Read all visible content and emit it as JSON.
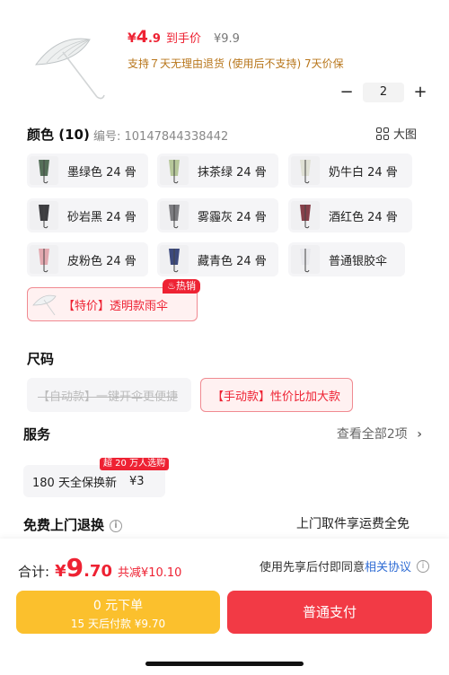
{
  "header": {
    "price_symbol": "¥",
    "price_int": "4",
    "price_dec": ".9",
    "price_label": "到手价",
    "original_price": "¥9.9",
    "policy": "支持７天无理由退货 (使用后不支持)  7天价保"
  },
  "stepper": {
    "minus": "−",
    "value": "2",
    "plus": "+"
  },
  "color": {
    "title": "颜色 (10)",
    "code": "编号: 10147844338442",
    "big_pic": "大图",
    "options": [
      {
        "label": "墨绿色 24 骨",
        "swatch": "#56705a"
      },
      {
        "label": "抹茶绿 24 骨",
        "swatch": "#b6c79a"
      },
      {
        "label": "奶牛白 24 骨",
        "swatch": "#dfe0d4"
      },
      {
        "label": "砂岩黑 24 骨",
        "swatch": "#3d3d40"
      },
      {
        "label": "雾霾灰 24 骨",
        "swatch": "#7c7c80"
      },
      {
        "label": "酒红色 24 骨",
        "swatch": "#86404a"
      },
      {
        "label": "皮粉色 24 骨",
        "swatch": "#e3a9b0"
      },
      {
        "label": "藏青色 24 骨",
        "swatch": "#3d4a7d"
      },
      {
        "label": "普通银胶伞",
        "swatch": "#e8e8ec"
      }
    ],
    "special": {
      "label": "【特价】透明款雨伞",
      "badge": "热销"
    }
  },
  "size": {
    "title": "尺码",
    "options": [
      {
        "label": "【自动款】一键开伞更便捷",
        "state": "disabled"
      },
      {
        "label": "【手动款】性价比加大款",
        "state": "selected"
      }
    ]
  },
  "service": {
    "title": "服务",
    "more": "查看全部2项",
    "more_icon": "chevron-right-icon",
    "card_label": "180 天全保换新",
    "card_price": "¥3",
    "badge": "超 20 万人选购"
  },
  "free_return": {
    "title": "免费上门退换",
    "info": "i",
    "right": "上门取件享运费全免"
  },
  "footer": {
    "total_label": "合计:",
    "total_symbol": "¥",
    "total_int": "9",
    "total_dec": ".70",
    "saving": "共减¥10.10",
    "agree_text": "使用先享后付即同意",
    "agree_link": "相关协议",
    "later_line1": "0 元下单",
    "later_line2": "15 天后付款 ¥9.70",
    "pay": "普通支付"
  },
  "colors": {
    "accent": "#ee2233",
    "gold": "#fbc02d",
    "link": "#2f6cd4"
  }
}
